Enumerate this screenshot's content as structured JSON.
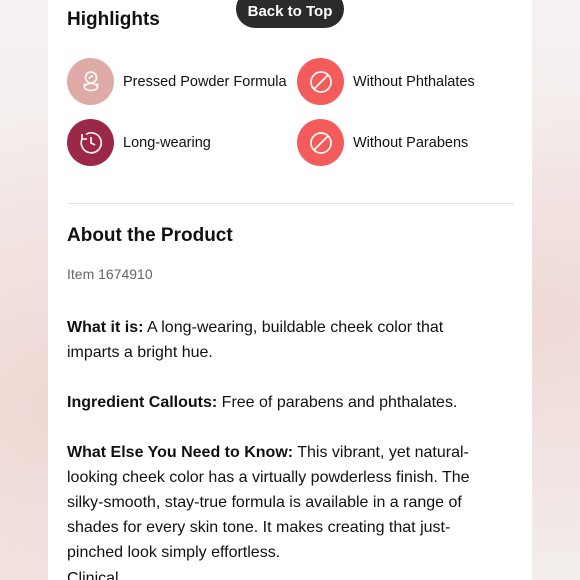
{
  "back_to_top": "Back to Top",
  "highlights": {
    "title": "Highlights",
    "items": [
      {
        "label": "Pressed Powder Formula",
        "icon": "powder-compact-icon",
        "color": "#deaba6"
      },
      {
        "label": "Without Phthalates",
        "icon": "prohibited-icon",
        "color": "#f45b5b"
      },
      {
        "label": "Long-wearing",
        "icon": "clock-icon",
        "color": "#9c2848"
      },
      {
        "label": "Without Parabens",
        "icon": "prohibited-icon",
        "color": "#f45b5b"
      }
    ]
  },
  "about": {
    "title": "About the Product",
    "item_number": "Item 1674910",
    "what_it_is": {
      "label": "What it is:",
      "text": " A long-wearing, buildable cheek color that imparts a bright hue."
    },
    "ingredient_callouts": {
      "label": "Ingredient Callouts:",
      "text": " Free of parabens and phthalates."
    },
    "what_else": {
      "label": "What Else You Need to Know:",
      "text": " This vibrant, yet natural-looking cheek color has a virtually powderless finish. The silky-smooth, stay-true formula is available in a range of shades for every skin tone. It makes creating that just-pinched look simply effortless."
    },
    "cut_off_text": "Clinical"
  },
  "colors": {
    "accent_red": "#f45b5b",
    "accent_plum": "#9c2848",
    "accent_nude": "#deaba6",
    "button_dark": "#2b2b2b"
  }
}
